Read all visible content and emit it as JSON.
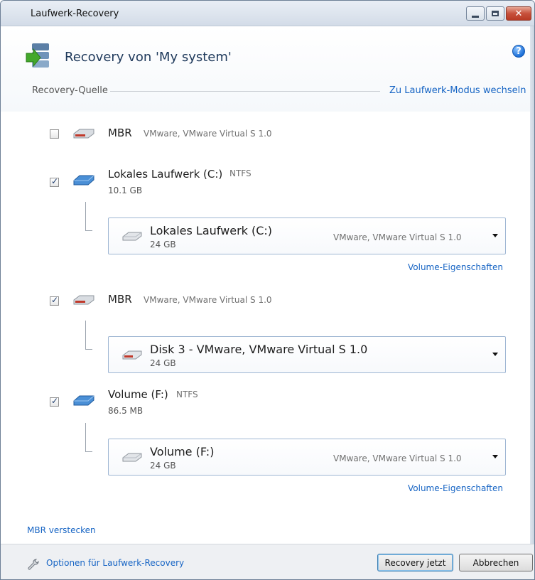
{
  "window": {
    "title": "Laufwerk-Recovery"
  },
  "header": {
    "title": "Recovery von 'My system'"
  },
  "source": {
    "label": "Recovery-Quelle",
    "switch_mode_link": "Zu Laufwerk-Modus wechseln"
  },
  "items": [
    {
      "name": "MBR",
      "meta": "VMware, VMware Virtual S 1.0",
      "size": "",
      "checked": false
    },
    {
      "name": "Lokales Laufwerk (C:)",
      "meta": "NTFS",
      "size": "10.1 GB",
      "checked": true,
      "target": {
        "name": "Lokales Laufwerk (C:)",
        "size": "24 GB",
        "model": "VMware, VMware Virtual S 1.0"
      },
      "link": "Volume-Eigenschaften"
    },
    {
      "name": "MBR",
      "meta": "VMware, VMware Virtual S 1.0",
      "size": "",
      "checked": true,
      "target": {
        "name": "Disk 3 - VMware, VMware Virtual S 1.0",
        "size": "24 GB",
        "model": ""
      }
    },
    {
      "name": "Volume (F:)",
      "meta": "NTFS",
      "size": "86.5 MB",
      "checked": true,
      "target": {
        "name": "Volume (F:)",
        "size": "24 GB",
        "model": "VMware, VMware Virtual S 1.0"
      },
      "link": "Volume-Eigenschaften"
    }
  ],
  "hide_mbr_link": "MBR verstecken",
  "footer": {
    "options_link": "Optionen für Laufwerk-Recovery",
    "recover_button": "Recovery jetzt",
    "cancel_button": "Abbrechen"
  },
  "colors": {
    "link": "#1664c4",
    "title": "#1e395b",
    "footer_bg": "#eef0f3"
  },
  "icons": [
    "app-recovery-icon",
    "help-icon",
    "mbr-disk-icon",
    "volume-disk-icon",
    "hdd-icon",
    "wrench-icon"
  ]
}
